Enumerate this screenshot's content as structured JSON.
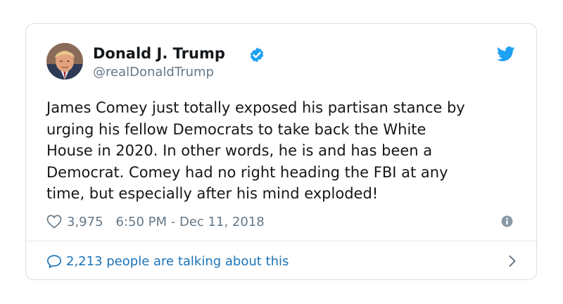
{
  "tweet": {
    "author": {
      "display_name": "Donald J. Trump",
      "handle": "@realDonaldTrump",
      "verified": true,
      "avatar_icon": "profile-photo"
    },
    "text_lines": [
      "James Comey just totally exposed his partisan stance by",
      "urging his fellow Democrats to take back the White",
      "House in 2020. In other words, he is and has been a",
      "Democrat. Comey had no right heading the FBI at any",
      "time, but especially after his mind exploded!"
    ],
    "likes": "3,975",
    "timestamp": "6:50 PM - Dec 11, 2018",
    "talking": "2,213 people are talking about this"
  },
  "icons": {
    "logo": "twitter-bird-icon",
    "like": "heart-icon",
    "info": "info-icon",
    "comment": "speech-bubble-icon",
    "chevron": "chevron-right-icon"
  },
  "colors": {
    "brand": "#1da1f2",
    "link": "#1b73b7",
    "muted": "#657786",
    "text": "#14171a",
    "border": "#d9dee3"
  }
}
